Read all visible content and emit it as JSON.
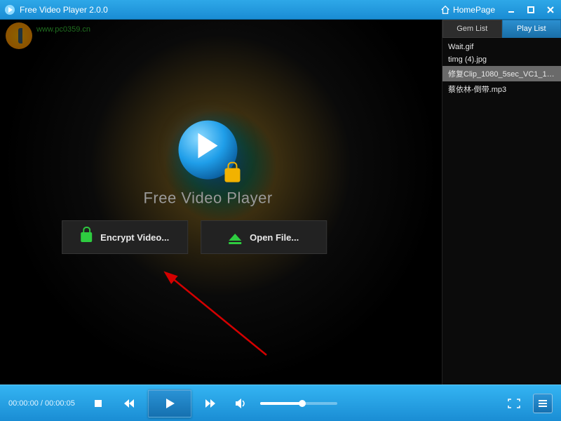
{
  "titlebar": {
    "title": "Free Video Player 2.0.0",
    "homepage_label": "HomePage"
  },
  "watermark": {
    "url_text": "www.pc0359.cn"
  },
  "splash": {
    "title": "Free Video Player",
    "encrypt_label": "Encrypt Video...",
    "open_label": "Open File..."
  },
  "sidebar": {
    "tabs": {
      "gem": "Gem List",
      "play": "Play List"
    },
    "active_tab": "play",
    "items": [
      {
        "label": "Wait.gif",
        "selected": false
      },
      {
        "label": "timg (4).jpg",
        "selected": false
      },
      {
        "label": "修复Clip_1080_5sec_VC1_15...",
        "selected": true
      },
      {
        "label": "蔡依林-倒带.mp3",
        "selected": false
      }
    ]
  },
  "controls": {
    "time_current": "00:00:00",
    "time_total": "00:00:05",
    "volume_percent": 55
  },
  "colors": {
    "accent": "#1a8dd4",
    "green": "#2ecc40"
  }
}
